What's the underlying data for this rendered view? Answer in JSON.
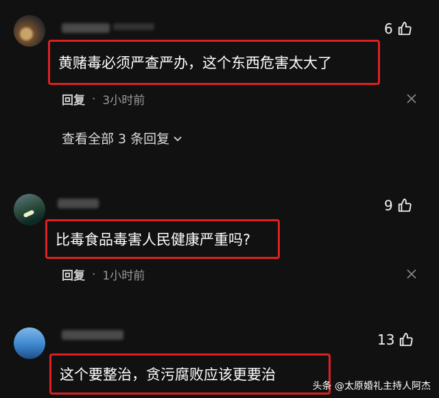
{
  "comments": [
    {
      "likes": "6",
      "text": "黄赌毒必须严查严办，这个东西危害太大了",
      "reply_label": "回复",
      "dot": "·",
      "time": "3小时前",
      "view_replies": "查看全部 3 条回复"
    },
    {
      "likes": "9",
      "text": "比毒食品毒害人民健康严重吗?",
      "reply_label": "回复",
      "dot": "·",
      "time": "1小时前"
    },
    {
      "likes": "13",
      "text": "这个要整治，贪污腐败应该更要治"
    }
  ],
  "watermark": "头条 @太原婚礼主持人阿杰",
  "icons": {
    "like": "thumbs-up-icon",
    "close": "close-icon",
    "chevron": "chevron-down-icon"
  },
  "colors": {
    "highlight": "#e02020",
    "background": "#111111"
  }
}
